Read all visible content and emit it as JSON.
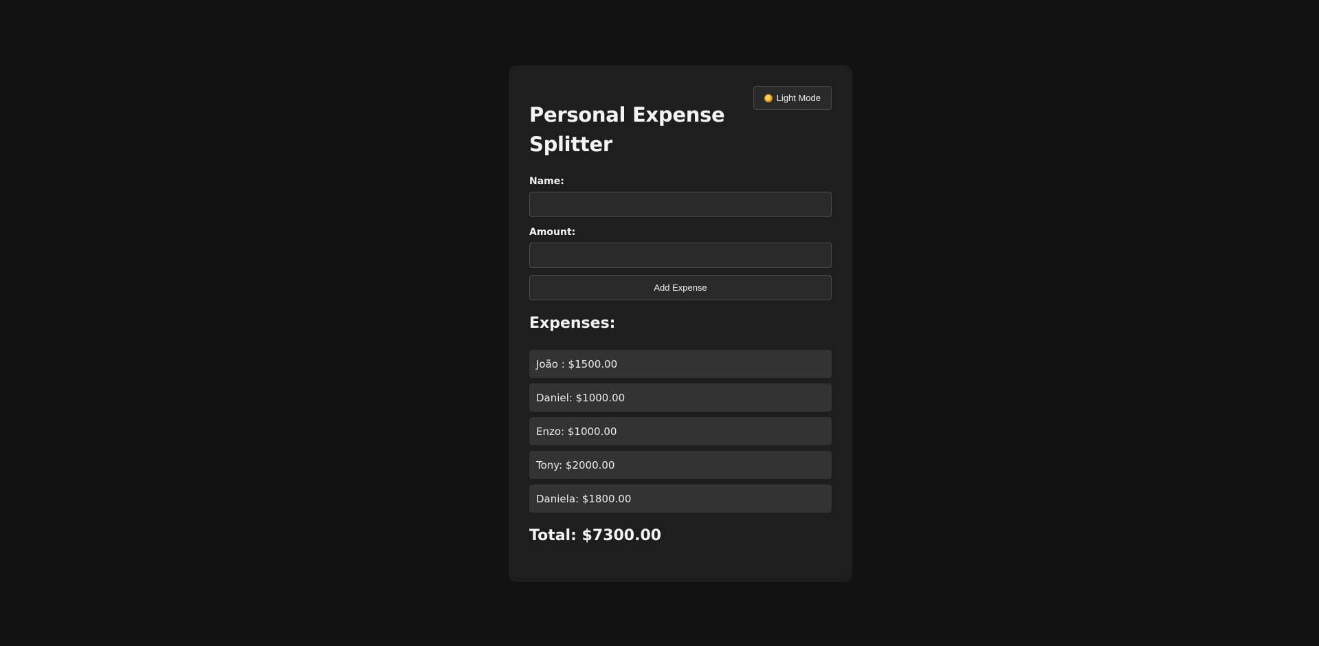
{
  "theme_toggle": {
    "icon": "sun-icon",
    "label": "Light Mode"
  },
  "title": "Personal Expense Splitter",
  "form": {
    "name_label": "Name:",
    "name_value": "",
    "amount_label": "Amount:",
    "amount_value": "",
    "add_button_label": "Add Expense"
  },
  "expenses_heading": "Expenses:",
  "expenses": [
    {
      "text": "João : $1500.00"
    },
    {
      "text": "Daniel: $1000.00"
    },
    {
      "text": "Enzo: $1000.00"
    },
    {
      "text": "Tony: $2000.00"
    },
    {
      "text": "Daniela: $1800.00"
    }
  ],
  "total": "Total: $7300.00",
  "colors": {
    "page_background": "#121212",
    "card_background": "#1e1e1e",
    "item_background": "#333333",
    "text": "#f2f2f2"
  }
}
